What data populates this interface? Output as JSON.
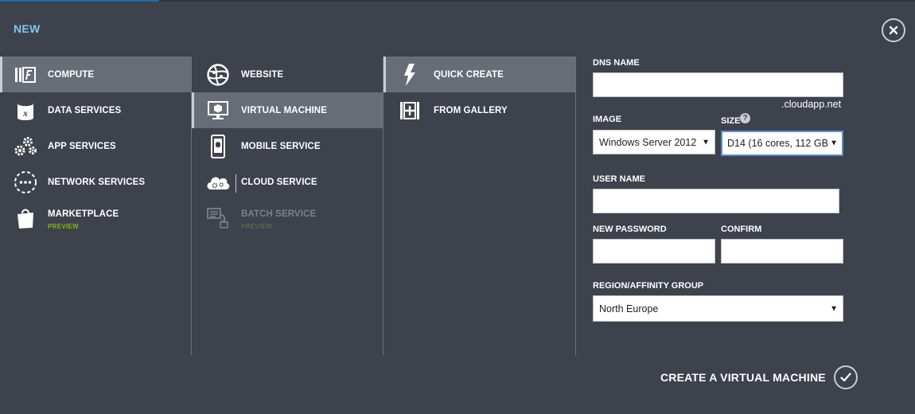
{
  "header": {
    "title": "NEW",
    "close_icon": "close-icon"
  },
  "categories": [
    {
      "label": "COMPUTE",
      "icon": "compute-icon",
      "selected": true
    },
    {
      "label": "DATA SERVICES",
      "icon": "data-services-icon"
    },
    {
      "label": "APP SERVICES",
      "icon": "app-services-icon"
    },
    {
      "label": "NETWORK SERVICES",
      "icon": "network-services-icon"
    },
    {
      "label": "MARKETPLACE",
      "sublabel": "PREVIEW",
      "icon": "marketplace-bag-icon"
    }
  ],
  "compute_items": [
    {
      "label": "WEBSITE",
      "icon": "website-globe-icon"
    },
    {
      "label": "VIRTUAL MACHINE",
      "icon": "virtual-machine-icon",
      "selected": true
    },
    {
      "label": "MOBILE SERVICE",
      "icon": "mobile-service-icon"
    },
    {
      "label": "CLOUD SERVICE",
      "icon": "cloud-service-icon"
    },
    {
      "label": "BATCH SERVICE",
      "sublabel": "PREVIEW",
      "icon": "batch-service-icon",
      "disabled": true
    }
  ],
  "vm_options": [
    {
      "label": "QUICK CREATE",
      "icon": "lightning-icon",
      "selected": true
    },
    {
      "label": "FROM GALLERY",
      "icon": "gallery-add-icon"
    }
  ],
  "form": {
    "dns_name": {
      "label": "DNS NAME",
      "value": "",
      "suffix": ".cloudapp.net"
    },
    "image": {
      "label": "IMAGE",
      "value": "Windows Server 2012"
    },
    "size": {
      "label": "SIZE",
      "help": "?",
      "value": "D14 (16 cores, 112 GB"
    },
    "user_name": {
      "label": "USER NAME",
      "value": ""
    },
    "new_password": {
      "label": "NEW PASSWORD",
      "value": ""
    },
    "confirm": {
      "label": "CONFIRM",
      "value": ""
    },
    "region": {
      "label": "REGION/AFFINITY GROUP",
      "value": "North Europe"
    }
  },
  "footer": {
    "create_label": "CREATE A VIRTUAL MACHINE",
    "icon": "checkmark-icon"
  },
  "colors": {
    "background": "#3d424d",
    "selected": "#676d77",
    "title_blue": "#7fc8ee",
    "preview_green": "#7fba00"
  }
}
